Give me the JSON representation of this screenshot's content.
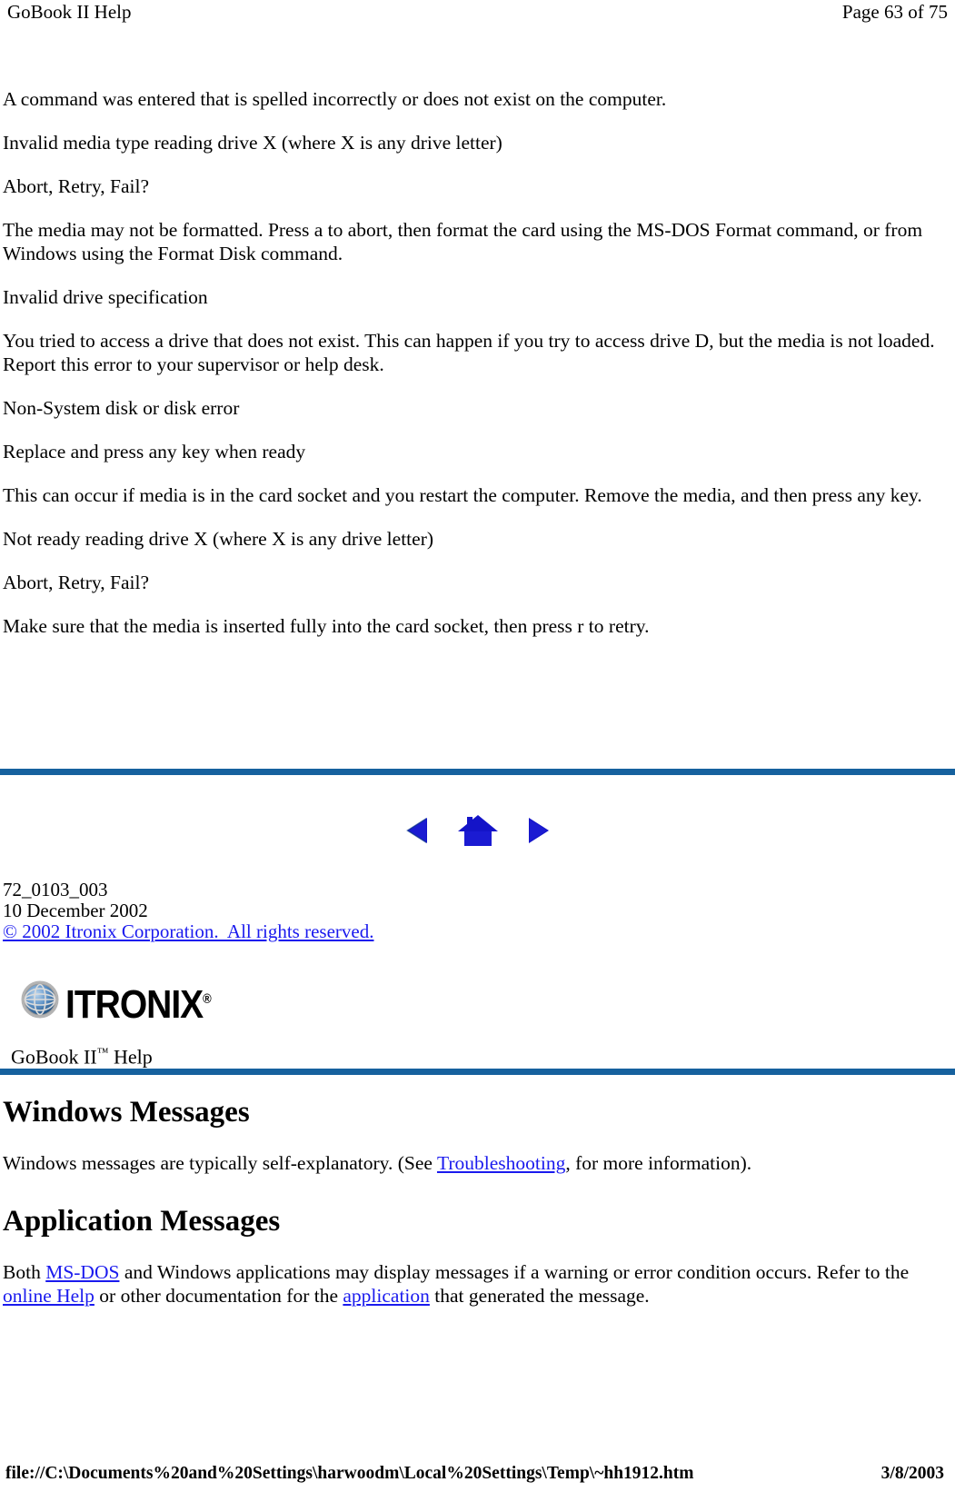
{
  "header": {
    "title": "GoBook II Help",
    "page_indicator": "Page 63 of 75"
  },
  "main": {
    "paragraphs": [
      "A command was entered that is spelled incorrectly or does not exist on the computer.",
      "Invalid media type reading drive X (where X is any drive letter)",
      "Abort, Retry, Fail?",
      "The media may not be formatted. Press a to abort, then format the card using the MS-DOS Format command, or from Windows using the Format Disk command.",
      "Invalid drive specification",
      "You tried to access a drive that does not exist. This can happen if you try to access drive D, but the media is not loaded. Report this error to your supervisor or help desk.",
      "Non-System disk or disk error",
      "Replace and press any key when ready",
      "This can occur if media is in the card socket and you restart the computer. Remove the media, and then press any key.",
      "Not ready reading drive X (where X is any drive letter)",
      "Abort, Retry, Fail?",
      "Make sure that the media is inserted fully into the card socket, then press r to retry."
    ]
  },
  "navigation": {
    "back_label": "back-arrow",
    "home_label": "home",
    "forward_label": "forward-arrow"
  },
  "credits": {
    "doc_number": "72_0103_003",
    "date": "10 December 2002",
    "copyright": "© 2002 Itronix Corporation.  All rights reserved."
  },
  "logo": {
    "wordmark": "ITRONIX",
    "registered": "®",
    "product_title_main": "GoBook II",
    "product_title_tm": "™",
    "product_title_suffix": " Help"
  },
  "article": {
    "heading_1": "Windows Messages",
    "windows_text_before": "Windows messages are typically self-explanatory. (See ",
    "windows_link": "Troubleshooting",
    "windows_text_after": ", for more information).",
    "heading_2": "Application Messages",
    "app_text_1": "Both ",
    "app_link_1": "MS-DOS",
    "app_text_2": " and Windows applications may display messages if a warning or error condition occurs. Refer to the ",
    "app_link_2": "online Help",
    "app_text_3": " or other documentation for the ",
    "app_link_3": "application",
    "app_text_4": " that generated the message."
  },
  "print_footer": {
    "url": "file://C:\\Documents%20and%20Settings\\harwoodm\\Local%20Settings\\Temp\\~hh1912.htm",
    "date": "3/8/2003"
  },
  "colors": {
    "rule_blue": "#16619E",
    "link_blue": "#1A1AEE",
    "nav_icon_blue": "#1414C8"
  }
}
